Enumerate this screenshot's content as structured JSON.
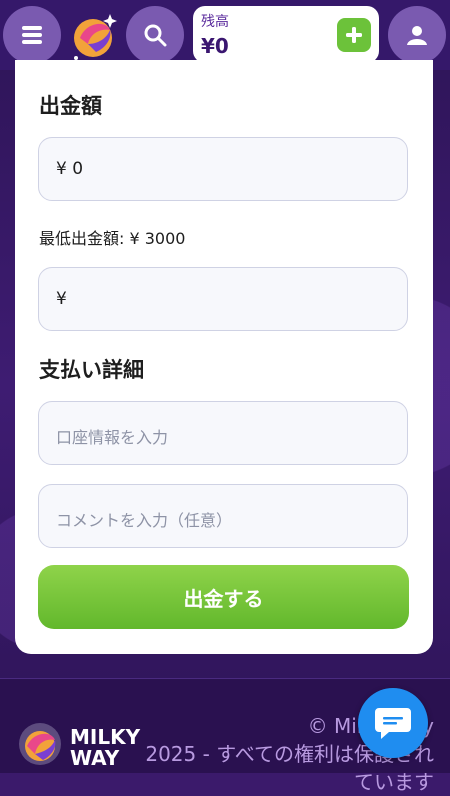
{
  "header": {
    "balance_label": "残高",
    "balance_value": "¥0"
  },
  "withdraw": {
    "title": "出金額",
    "amount_value": "¥ 0",
    "min_label": "最低出金額: ¥ 3000",
    "amount_input_prefix": "¥"
  },
  "payment": {
    "title": "支払い詳細",
    "account_placeholder": "口座情報を入力",
    "comment_placeholder": "コメントを入力（任意）"
  },
  "submit_label": "出金する",
  "footer": {
    "brand_line1": "MILKY",
    "brand_line2": "WAY",
    "copyright_line1": "© Milky Way",
    "copyright_line2": "2025 - すべての権利は保護され",
    "copyright_line3": "ています"
  },
  "colors": {
    "accent_purple": "#35186a",
    "submit_green": "#6cc23a",
    "chat_blue": "#1f8df0"
  }
}
